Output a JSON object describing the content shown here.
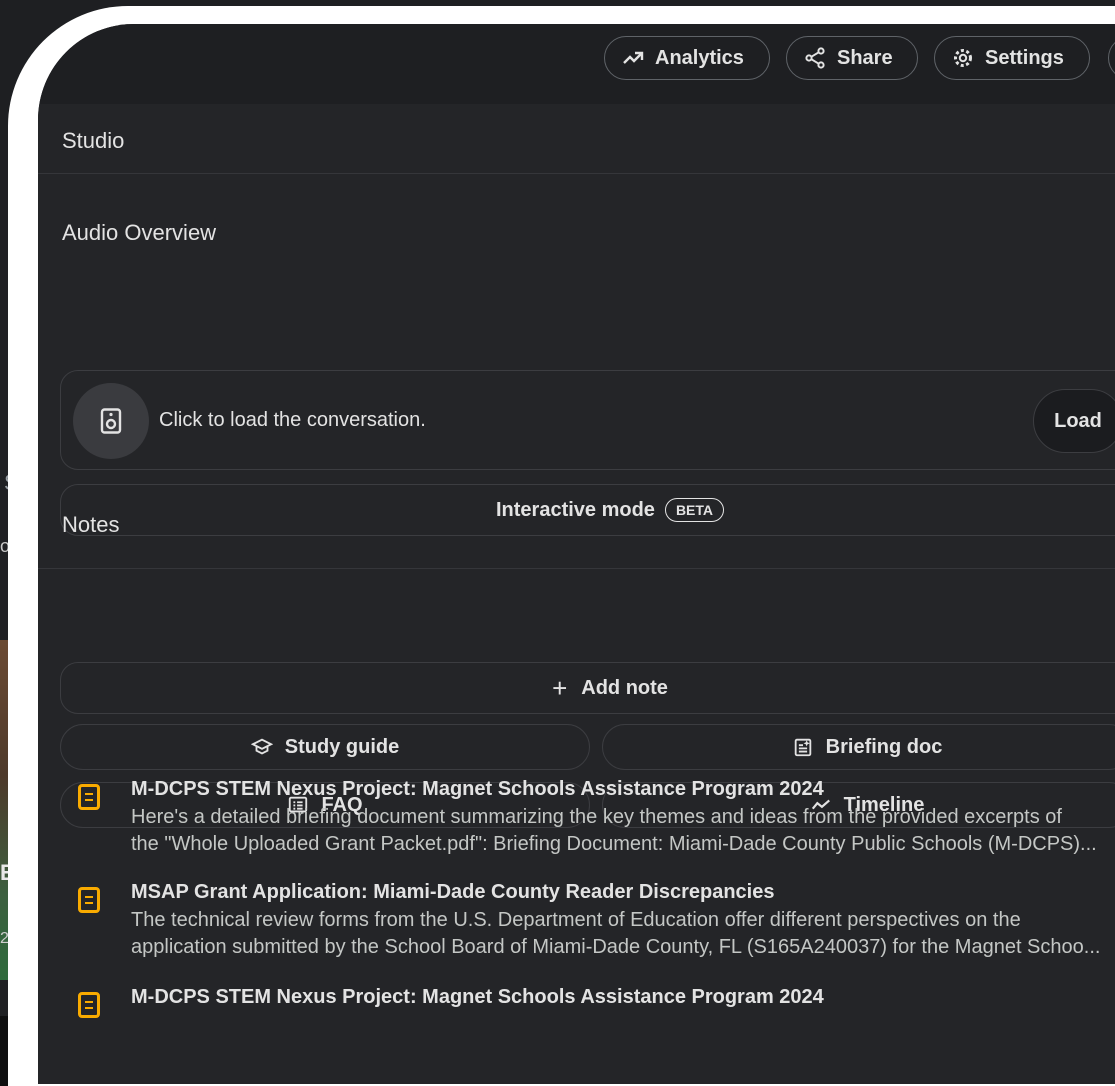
{
  "background": {
    "fragment_1": "o",
    "fragment_2": "Ey",
    "fragment_3": "2",
    "fragment_4": "S"
  },
  "topbar": {
    "analytics_label": "Analytics",
    "share_label": "Share",
    "settings_label": "Settings"
  },
  "studio": {
    "title": "Studio",
    "audio_overview": {
      "title": "Audio Overview",
      "prompt": "Click to load the conversation.",
      "load_label": "Load",
      "interactive_label": "Interactive mode",
      "beta_badge": "BETA"
    },
    "notes": {
      "title": "Notes",
      "add_note_label": "Add note",
      "study_guide_label": "Study guide",
      "briefing_doc_label": "Briefing doc",
      "faq_label": "FAQ",
      "timeline_label": "Timeline",
      "items": [
        {
          "title": "M-DCPS STEM Nexus Project: Magnet Schools Assistance Program 2024",
          "line1": "Here's a detailed briefing document summarizing the key themes and ideas from the provided excerpts of",
          "line2": "the \"Whole Uploaded Grant Packet.pdf\": Briefing Document: Miami-Dade County Public Schools (M-DCPS)..."
        },
        {
          "title": "MSAP Grant Application: Miami-Dade County Reader Discrepancies",
          "line1": "The technical review forms from the U.S. Department of Education offer different perspectives on the",
          "line2": "application submitted by the School Board of Miami-Dade County, FL (S165A240037) for the Magnet Schoo..."
        },
        {
          "title": "M-DCPS STEM Nexus Project: Magnet Schools Assistance Program 2024",
          "line1": "",
          "line2": ""
        }
      ]
    }
  },
  "colors": {
    "note_icon": "#f9ab00",
    "panel_bg": "#242528",
    "frame": "#ffffff"
  }
}
